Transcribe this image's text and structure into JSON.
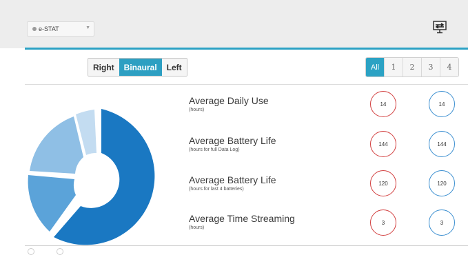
{
  "header": {
    "device_select": "e-STAT"
  },
  "side_switch": {
    "options": [
      "Right",
      "Binaural",
      "Left"
    ],
    "selected": "Binaural"
  },
  "device_tabs": {
    "options": [
      "All",
      "1",
      "2",
      "3",
      "4"
    ],
    "selected": "All"
  },
  "donut_chart": {
    "colors": [
      "#1a78c2",
      "#5ba3d9",
      "#8fbfe5",
      "#c3dcf1"
    ]
  },
  "metrics": [
    {
      "title": "Average Daily Use",
      "subtitle": "(hours)",
      "left_value": "14",
      "right_value": "14"
    },
    {
      "title": "Average Battery Life",
      "subtitle": "(hours for full Data Log)",
      "left_value": "144",
      "right_value": "144"
    },
    {
      "title": "Average Battery Life",
      "subtitle": "(hours for last 4 batteries)",
      "left_value": "120",
      "right_value": "120"
    },
    {
      "title": "Average Time Streaming",
      "subtitle": "(hours)",
      "left_value": "3",
      "right_value": "3"
    }
  ],
  "colors": {
    "accent": "#2ba2c4",
    "left_ring": "#d23f3f",
    "right_ring": "#3a8ed0"
  }
}
